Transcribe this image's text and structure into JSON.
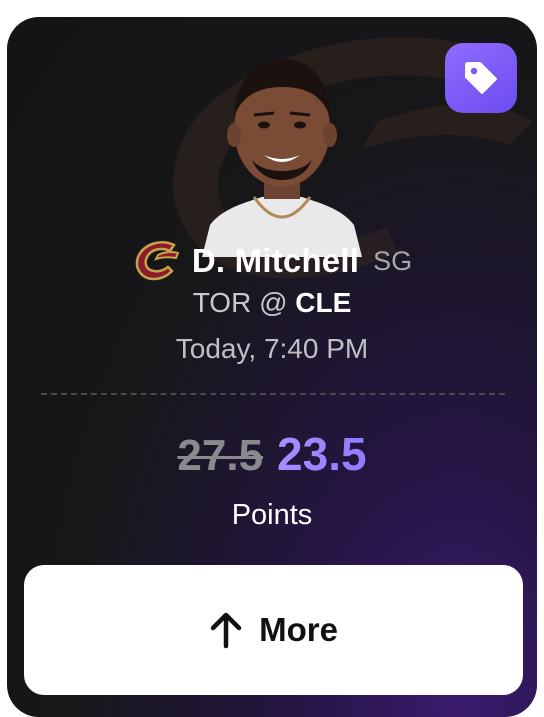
{
  "card": {
    "background_accent": "#3a1a6e",
    "promo_badge_icon": "tag-icon",
    "promo_badge_color": "#7a5af8"
  },
  "player": {
    "name": "D. Mitchell",
    "position": "SG",
    "team_logo_icon": "cavaliers-logo-icon"
  },
  "game": {
    "away": "TOR",
    "separator": "@",
    "home": "CLE",
    "time": "Today, 7:40 PM"
  },
  "projection": {
    "old_line": "27.5",
    "new_line": "23.5",
    "stat": "Points",
    "new_line_color": "#a88dff"
  },
  "action": {
    "label": "More",
    "icon": "arrow-up-icon"
  }
}
